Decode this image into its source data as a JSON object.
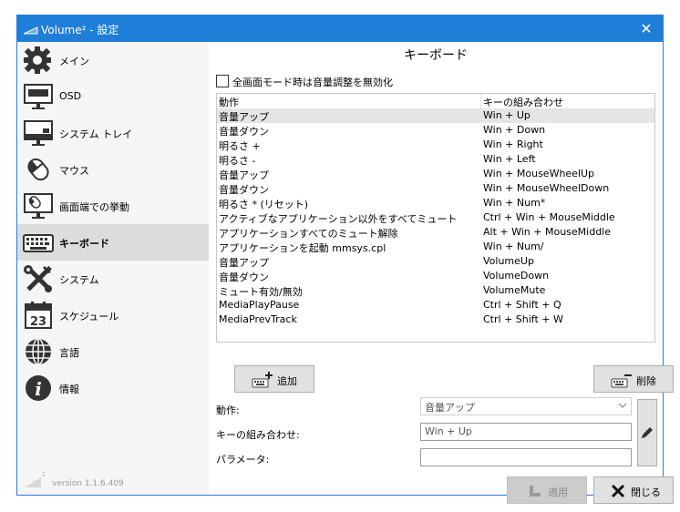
{
  "window": {
    "title": "Volume² - 設定",
    "close_glyph": "✕"
  },
  "sidebar": {
    "items": [
      {
        "label": "メイン",
        "icon": "gear-icon"
      },
      {
        "label": "OSD",
        "icon": "monitor-icon"
      },
      {
        "label": "システム トレイ",
        "icon": "system-tray-icon"
      },
      {
        "label": "マウス",
        "icon": "mouse-icon"
      },
      {
        "label": "画面端での挙動",
        "icon": "screen-edge-icon"
      },
      {
        "label": "キーボード",
        "icon": "keyboard-icon",
        "active": true
      },
      {
        "label": "システム",
        "icon": "tools-icon"
      },
      {
        "label": "スケジュール",
        "icon": "calendar-icon",
        "calendar_day": "23"
      },
      {
        "label": "言語",
        "icon": "globe-icon"
      },
      {
        "label": "情報",
        "icon": "info-icon",
        "info_glyph": "i"
      }
    ],
    "version": "version 1.1.6.409",
    "version_badge": "2"
  },
  "content": {
    "title": "キーボード",
    "disable_fullscreen_label": "全画面モード時は音量調整を無効化",
    "table": {
      "headers": [
        "動作",
        "キーの組み合わせ"
      ],
      "rows": [
        [
          "音量アップ",
          "Win + Up"
        ],
        [
          "音量ダウン",
          "Win + Down"
        ],
        [
          "明るさ +",
          "Win + Right"
        ],
        [
          "明るさ -",
          "Win + Left"
        ],
        [
          "音量アップ",
          "Win + MouseWheelUp"
        ],
        [
          "音量ダウン",
          "Win + MouseWheelDown"
        ],
        [
          "明るさ * (リセット)",
          "Win + Num*"
        ],
        [
          "アクティブなアプリケーション以外をすべてミュート",
          "Ctrl + Win + MouseMiddle"
        ],
        [
          "アプリケーションすべてのミュート解除",
          "Alt + Win + MouseMiddle"
        ],
        [
          "アプリケーションを起動 mmsys.cpl",
          "Win + Num/"
        ],
        [
          "音量アップ",
          "VolumeUp"
        ],
        [
          "音量ダウン",
          "VolumeDown"
        ],
        [
          "ミュート有効/無効",
          "VolumeMute"
        ],
        [
          "MediaPlayPause",
          "Ctrl + Shift + Q"
        ],
        [
          "MediaPrevTrack",
          "Ctrl + Shift + W"
        ]
      ],
      "selected_row": 0
    },
    "add_label": "追加",
    "delete_label": "削除",
    "action_label": "動作:",
    "action_value": "音量アップ",
    "combo_label": "キーの組み合わせ:",
    "combo_value": "Win + Up",
    "param_label": "パラメータ:",
    "param_value": "",
    "apply_label": "適用",
    "close_label": "閉じる"
  },
  "colors": {
    "titlebar": "#1f7fd8",
    "selected_item": "#dcdcdc"
  }
}
